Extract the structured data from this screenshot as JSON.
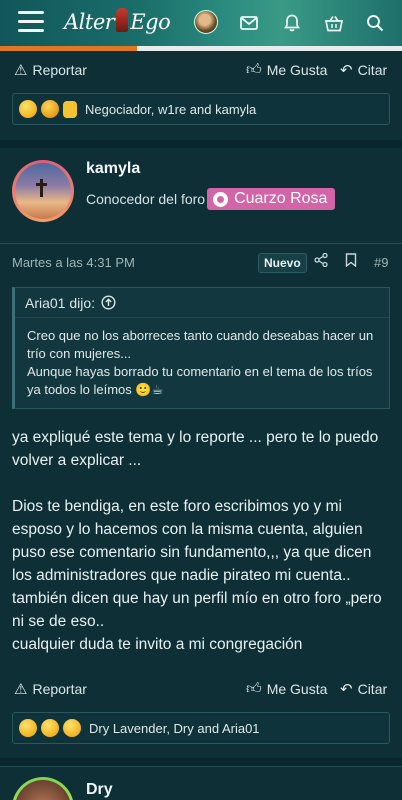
{
  "header": {
    "logo_left": "Alter",
    "logo_right": "Ego",
    "icons": [
      "menu-icon",
      "avatar",
      "mail-icon",
      "bell-icon",
      "basket-icon",
      "search-icon"
    ],
    "progress_fraction": 0.34
  },
  "post_top": {
    "report_label": "Reportar",
    "like_label": "Me Gusta",
    "quote_label": "Citar",
    "reactions_text": "Negociador, w1re and kamyla"
  },
  "post": {
    "username": "kamyla",
    "user_title": "Conocedor del foro",
    "badge": "Cuarzo Rosa",
    "date": "Martes a las 4:31 PM",
    "new_badge": "Nuevo",
    "post_number": "#9",
    "quote": {
      "author": "Aria01 dijo:",
      "line1": "Creo que no los aborreces tanto cuando deseabas hacer un trío con mujeres...",
      "line2": "Aunque hayas borrado tu comentario en el tema de los tríos ya todos lo leímos 🙂☕"
    },
    "body_p1": "ya expliqué este tema y lo reporte ... pero te lo puedo volver a explicar ...",
    "body_p2": "Dios te bendiga, en este foro escribimos yo y mi esposo y lo hacemos con la misma cuenta, alguien puso ese comentario sin fundamento,,, ya que dicen los administradores que nadie pirateo mi cuenta.. también dicen que hay un perfil mío en otro foro „pero ni se de eso..",
    "body_p3": "cualquier duda te invito a mi congregación",
    "report_label": "Reportar",
    "like_label": "Me Gusta",
    "quote_label": "Citar",
    "reactions_text": "Dry Lavender, Dry and Aria01"
  },
  "next_post": {
    "username": "Dry"
  }
}
